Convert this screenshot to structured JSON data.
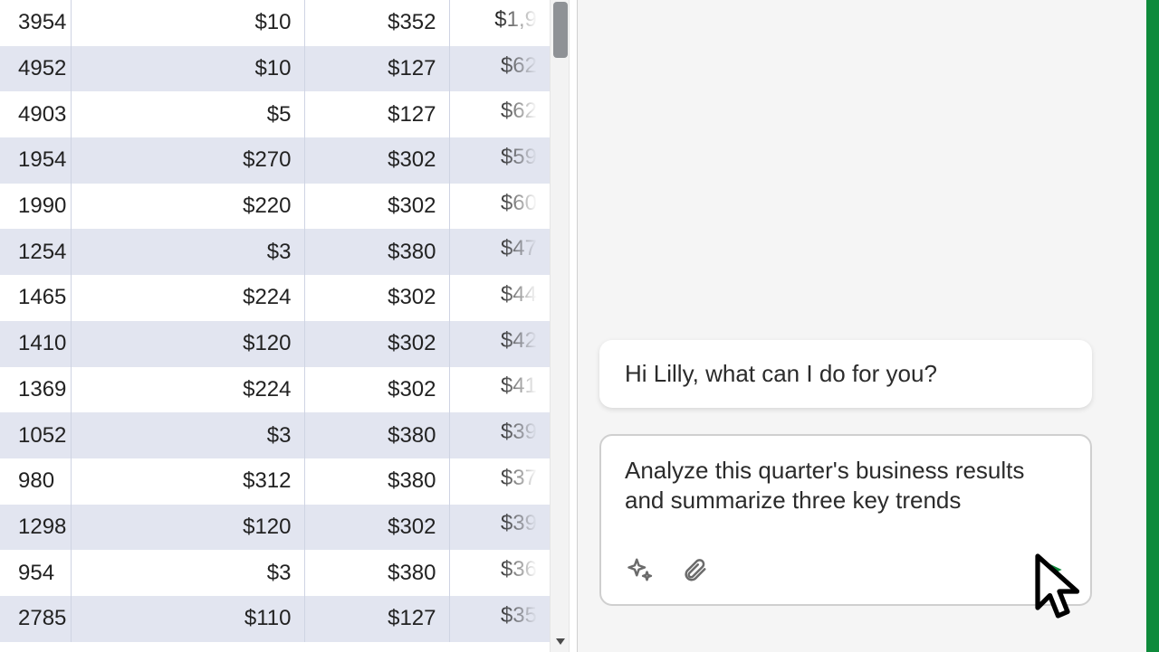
{
  "sheet": {
    "rows": [
      {
        "c1": "3954",
        "c2": "$10",
        "c3": "$352",
        "c4": "$1,9"
      },
      {
        "c1": "4952",
        "c2": "$10",
        "c3": "$127",
        "c4": "$62"
      },
      {
        "c1": "4903",
        "c2": "$5",
        "c3": "$127",
        "c4": "$62"
      },
      {
        "c1": "1954",
        "c2": "$270",
        "c3": "$302",
        "c4": "$59"
      },
      {
        "c1": "1990",
        "c2": "$220",
        "c3": "$302",
        "c4": "$60"
      },
      {
        "c1": "1254",
        "c2": "$3",
        "c3": "$380",
        "c4": "$47"
      },
      {
        "c1": "1465",
        "c2": "$224",
        "c3": "$302",
        "c4": "$44"
      },
      {
        "c1": "1410",
        "c2": "$120",
        "c3": "$302",
        "c4": "$42"
      },
      {
        "c1": "1369",
        "c2": "$224",
        "c3": "$302",
        "c4": "$41"
      },
      {
        "c1": "1052",
        "c2": "$3",
        "c3": "$380",
        "c4": "$39"
      },
      {
        "c1": "980",
        "c2": "$312",
        "c3": "$380",
        "c4": "$37"
      },
      {
        "c1": "1298",
        "c2": "$120",
        "c3": "$302",
        "c4": "$39"
      },
      {
        "c1": "954",
        "c2": "$3",
        "c3": "$380",
        "c4": "$36"
      },
      {
        "c1": "2785",
        "c2": "$110",
        "c3": "$127",
        "c4": "$35"
      }
    ]
  },
  "chat": {
    "assistant_message": "Hi Lilly, what can I do for you?",
    "compose_text": "Analyze this quarter's business results and summarize three key trends"
  },
  "icons": {
    "sparkle": "sparkle-icon",
    "attach": "paperclip-icon",
    "send": "send-icon",
    "scroll_down": "chevron-down-icon"
  },
  "colors": {
    "accent": "#0e8a3b",
    "row_alt": "#e2e5f0"
  }
}
